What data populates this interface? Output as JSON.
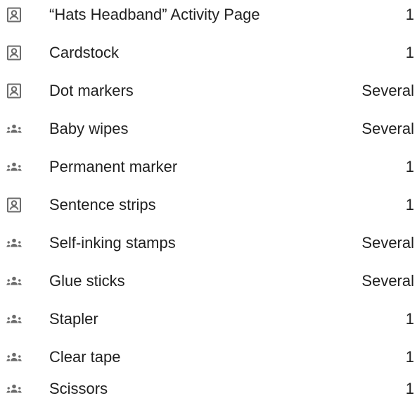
{
  "materials": [
    {
      "icon": "individual-student-icon",
      "label": "“Hats Headband” Activity Page",
      "qty": "1"
    },
    {
      "icon": "individual-student-icon",
      "label": "Cardstock",
      "qty": "1"
    },
    {
      "icon": "individual-student-icon",
      "label": "Dot markers",
      "qty": "Several"
    },
    {
      "icon": "group-icon",
      "label": "Baby wipes",
      "qty": "Several"
    },
    {
      "icon": "group-icon",
      "label": "Permanent marker",
      "qty": "1"
    },
    {
      "icon": "individual-student-icon",
      "label": "Sentence strips",
      "qty": "1"
    },
    {
      "icon": "group-icon",
      "label": "Self-inking stamps",
      "qty": "Several"
    },
    {
      "icon": "group-icon",
      "label": "Glue sticks",
      "qty": "Several"
    },
    {
      "icon": "group-icon",
      "label": "Stapler",
      "qty": "1"
    },
    {
      "icon": "group-icon",
      "label": "Clear tape",
      "qty": "1"
    },
    {
      "icon": "group-icon",
      "label": "Scissors",
      "qty": "1"
    }
  ],
  "colors": {
    "text": "#1f1f1f",
    "icon": "#6b6b6b"
  }
}
